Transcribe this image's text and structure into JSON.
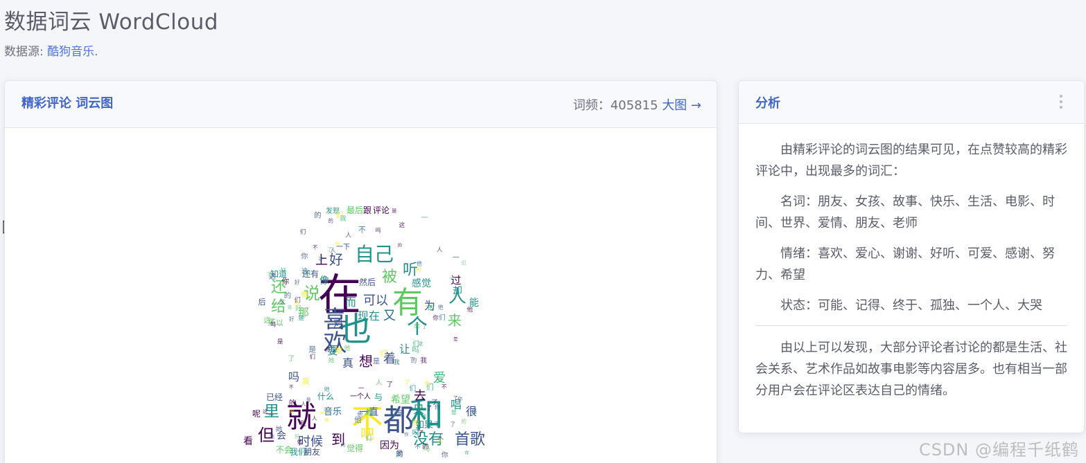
{
  "header": {
    "title": "数据词云 WordCloud",
    "source_label": "数据源:",
    "source_link": "酷狗音乐",
    "source_suffix": "."
  },
  "main_card": {
    "title": "精彩评论 词云图",
    "freq_label": "词频：405815",
    "big_link": "大图 →"
  },
  "side_card": {
    "title": "分析",
    "paragraphs": [
      "由精彩评论的词云图的结果可见，在点赞较高的精彩评论中，出现最多的词汇：",
      "名词：朋友、女孩、故事、快乐、生活、电影、时间、世界、爱情、朋友、老师",
      "情绪：喜欢、爱心、谢谢、好听、可爱、感谢、努力、希望",
      "状态：可能、记得、终于、孤独、一个人、大哭"
    ],
    "conclusion": "由以上可以发现，大部分评论者讨论的都是生活、社会关系、艺术作品如故事电影等内容居多。也有相当一部分用户会在评论区表达自己的情绪。"
  },
  "wordcloud": {
    "colors": [
      "#440154",
      "#3b528b",
      "#21918c",
      "#5ec962",
      "#fde725",
      "#31688e",
      "#35b779",
      "#482878"
    ],
    "words": [
      "在",
      "也",
      "有",
      "自己",
      "喜欢",
      "说",
      "还",
      "给",
      "好",
      "听",
      "被",
      "人",
      "个",
      "就",
      "不",
      "和",
      "都",
      "但",
      "里",
      "到",
      "吧",
      "没有",
      "首歌",
      "时候",
      "想",
      "着",
      "真",
      "要",
      "而",
      "可以",
      "现在",
      "又",
      "对",
      "让",
      "来",
      "过",
      "为",
      "那",
      "知道",
      "后",
      "所以",
      "看",
      "会",
      "吗",
      "爱",
      "去",
      "只",
      "很",
      "唱",
      "希望",
      "一直",
      "音乐",
      "如果",
      "因为",
      "觉得",
      "已经",
      "什么",
      "呢",
      "上",
      "感觉",
      "像",
      "然后",
      "最后",
      "跟",
      "评论",
      "发现",
      "能",
      "却",
      "一下",
      "还有",
      "一个人",
      "与",
      "我们",
      "不会",
      "朋友"
    ]
  },
  "watermark": "CSDN @编程千纸鹤"
}
